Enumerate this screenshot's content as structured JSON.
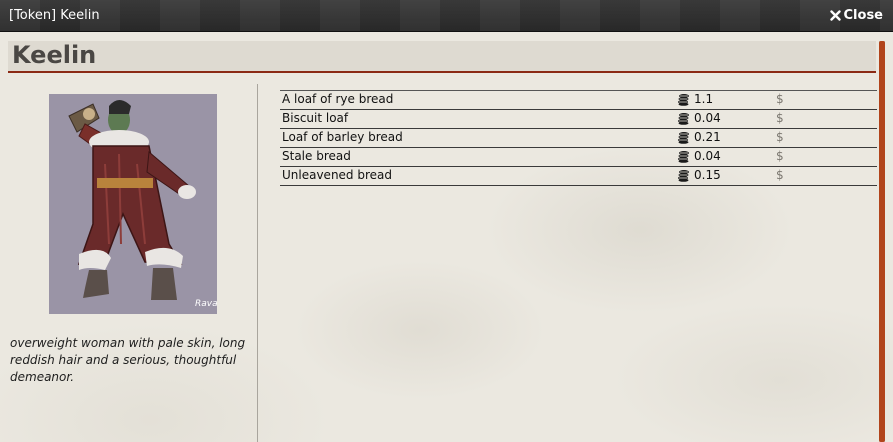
{
  "window": {
    "title": "[Token] Keelin",
    "close_label": "Close"
  },
  "header": {
    "name": "Keelin"
  },
  "description": "overweight woman with pale skin, long reddish hair and a serious, thoughtful demeanor.",
  "portrait_signature": "Rava",
  "items": [
    {
      "name": "A loaf of rye bread",
      "cost": "1.1",
      "currency_symbol": "$"
    },
    {
      "name": "Biscuit loaf",
      "cost": "0.04",
      "currency_symbol": "$"
    },
    {
      "name": "Loaf of barley bread",
      "cost": "0.21",
      "currency_symbol": "$"
    },
    {
      "name": "Stale bread",
      "cost": "0.04",
      "currency_symbol": "$"
    },
    {
      "name": "Unleavened bread",
      "cost": "0.15",
      "currency_symbol": "$"
    }
  ],
  "colors": {
    "accent": "#8b2a14",
    "scrollbar": "#b1441b",
    "titlebar": "#2f2f2f",
    "parchment": "#ebe8e0"
  },
  "icons": {
    "close": "close-icon",
    "coin": "coin-stack-icon"
  }
}
